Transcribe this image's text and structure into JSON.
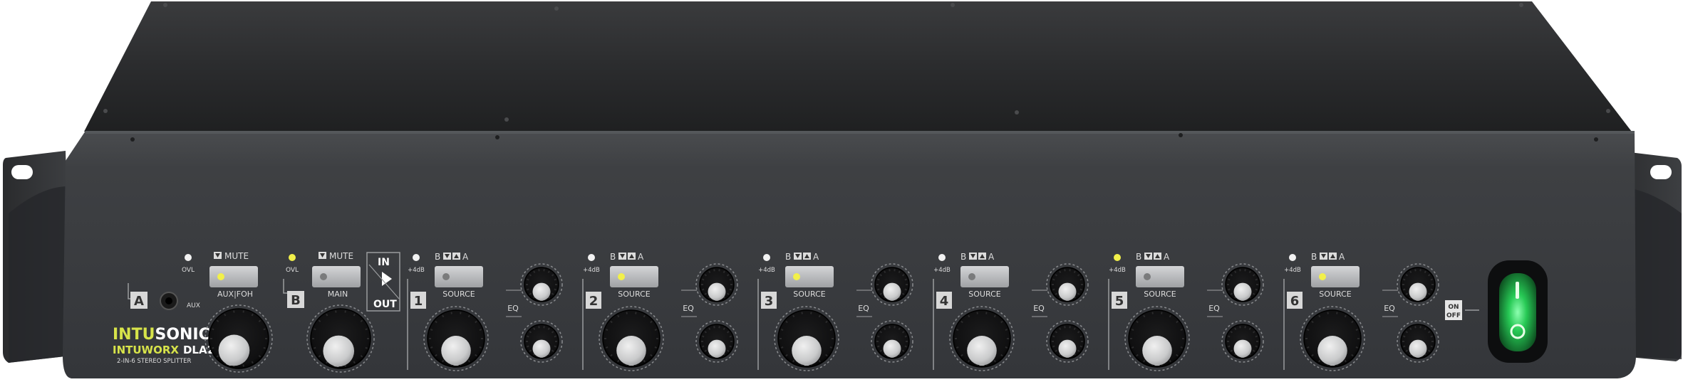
{
  "brand": {
    "logo_part1": "INTU",
    "logo_part2": "SONIC",
    "model_prefix": "INTU",
    "model_mid": "WORX",
    "model_name": "DLA26",
    "subtitle": "2-IN-6 STEREO SPLITTER",
    "logo_color": "#d7e34a"
  },
  "input_a": {
    "id": "A",
    "ovl": "OVL",
    "mute": "MUTE",
    "button_label": "AUX|FOH",
    "aux_label": "AUX",
    "led_on": true
  },
  "input_b": {
    "id": "B",
    "ovl": "OVL",
    "mute": "MUTE",
    "button_label": "MAIN",
    "led_on": false,
    "ovl_led_on": true
  },
  "routing": {
    "in": "IN",
    "out": "OUT"
  },
  "channels": [
    {
      "number": "1",
      "plus4": "+4dB",
      "sel_b": "B",
      "sel_a": "A",
      "source": "SOURCE",
      "eq": "EQ",
      "source_led_on": false,
      "plus4_led_on": false
    },
    {
      "number": "2",
      "plus4": "+4dB",
      "sel_b": "B",
      "sel_a": "A",
      "source": "SOURCE",
      "eq": "EQ",
      "source_led_on": true,
      "plus4_led_on": false
    },
    {
      "number": "3",
      "plus4": "+4dB",
      "sel_b": "B",
      "sel_a": "A",
      "source": "SOURCE",
      "eq": "EQ",
      "source_led_on": true,
      "plus4_led_on": false
    },
    {
      "number": "4",
      "plus4": "+4dB",
      "sel_b": "B",
      "sel_a": "A",
      "source": "SOURCE",
      "eq": "EQ",
      "source_led_on": false,
      "plus4_led_on": false
    },
    {
      "number": "5",
      "plus4": "+4dB",
      "sel_b": "B",
      "sel_a": "A",
      "source": "SOURCE",
      "eq": "EQ",
      "source_led_on": false,
      "plus4_led_on": true
    },
    {
      "number": "6",
      "plus4": "+4dB",
      "sel_b": "B",
      "sel_a": "A",
      "source": "SOURCE",
      "eq": "EQ",
      "source_led_on": true,
      "plus4_led_on": false
    }
  ],
  "power": {
    "on": "ON",
    "off": "OFF",
    "state_on": true,
    "glow_color": "#39e36a"
  },
  "colors": {
    "panel": "#3c3e40",
    "top": "#2a2b2c",
    "label": "#dcdcdc",
    "led_yellow": "#f2f04a",
    "button": "#b9bbbd"
  }
}
